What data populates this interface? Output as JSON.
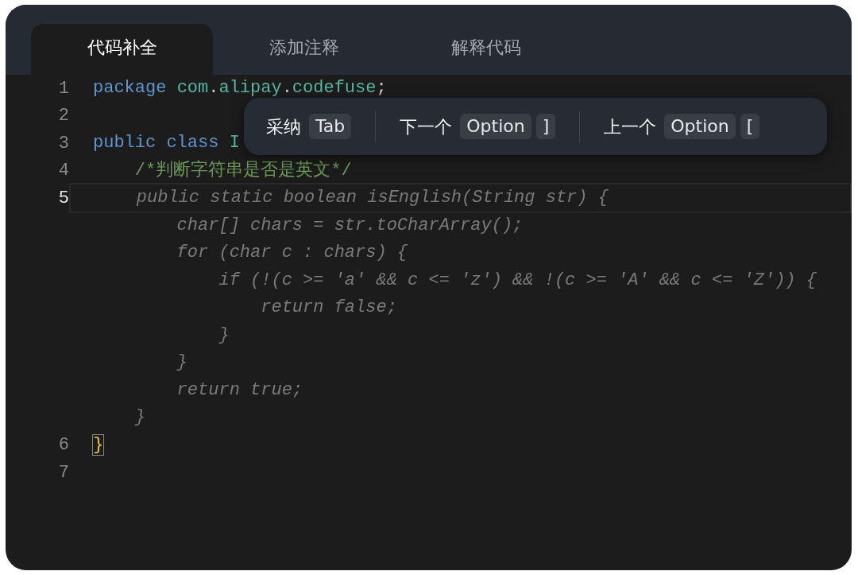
{
  "tabs": [
    {
      "label": "代码补全",
      "selected": true
    },
    {
      "label": "添加注释",
      "selected": false
    },
    {
      "label": "解释代码",
      "selected": false
    }
  ],
  "editor": {
    "lines": [
      {
        "number": "1",
        "current": false,
        "tokens": [
          {
            "text": "package ",
            "kind": "keyword"
          },
          {
            "text": "com",
            "kind": "ident"
          },
          {
            "text": ".",
            "kind": "plain"
          },
          {
            "text": "alipay",
            "kind": "ident"
          },
          {
            "text": ".",
            "kind": "plain"
          },
          {
            "text": "codefuse",
            "kind": "ident"
          },
          {
            "text": ";",
            "kind": "plain"
          }
        ]
      },
      {
        "number": "2",
        "current": false
      },
      {
        "number": "3",
        "current": false,
        "tokens": [
          {
            "text": "public class ",
            "kind": "keyword"
          },
          {
            "text": "I",
            "kind": "ident"
          }
        ]
      },
      {
        "number": "4",
        "current": false,
        "tokens": [
          {
            "text": "    /*判断字符串是否是英文*/",
            "kind": "comment"
          }
        ]
      },
      {
        "number": "5",
        "current": true,
        "tokens": [
          {
            "text": "    public static boolean isEnglish(String str) {",
            "kind": "ghost"
          }
        ]
      },
      {
        "current": false,
        "tokens": [
          {
            "text": "        char[] chars = str.toCharArray();",
            "kind": "ghost"
          }
        ]
      },
      {
        "current": false,
        "tokens": [
          {
            "text": "        for (char c : chars) {",
            "kind": "ghost"
          }
        ]
      },
      {
        "current": false,
        "tokens": [
          {
            "text": "            if (!(c >= 'a' && c <= 'z') && !(c >= 'A' && c <= 'Z')) {",
            "kind": "ghost"
          }
        ]
      },
      {
        "current": false,
        "tokens": [
          {
            "text": "                return false;",
            "kind": "ghost"
          }
        ]
      },
      {
        "current": false,
        "tokens": [
          {
            "text": "            }",
            "kind": "ghost"
          }
        ]
      },
      {
        "current": false,
        "tokens": [
          {
            "text": "        }",
            "kind": "ghost"
          }
        ]
      },
      {
        "current": false,
        "tokens": [
          {
            "text": "        return true;",
            "kind": "ghost"
          }
        ]
      },
      {
        "current": false,
        "tokens": [
          {
            "text": "    }",
            "kind": "ghost"
          }
        ]
      },
      {
        "number": "6",
        "current": false,
        "tokens": [
          {
            "text": "}",
            "kind": "match"
          }
        ]
      },
      {
        "number": "7",
        "current": false
      }
    ]
  },
  "popup": {
    "actions": [
      {
        "label": "采纳",
        "keys": [
          "Tab"
        ]
      },
      {
        "label": "下一个",
        "keys": [
          "Option",
          "]"
        ]
      },
      {
        "label": "上一个",
        "keys": [
          "Option",
          "["
        ]
      }
    ]
  }
}
